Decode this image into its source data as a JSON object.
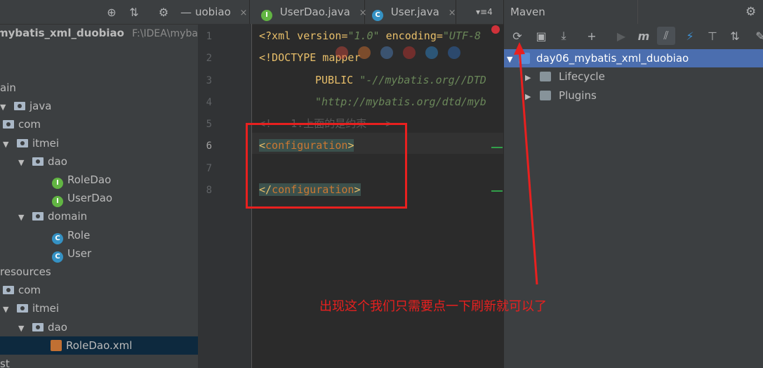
{
  "project": {
    "header_icons": [
      "globe-icon",
      "collapse-icon",
      "gear-icon",
      "minimize-icon"
    ],
    "root": {
      "name": "mybatis_xml_duobiao",
      "path": "F:\\IDEA\\mybatis\\"
    },
    "tree": [
      {
        "label": "ain",
        "depth": 0,
        "kind": "text"
      },
      {
        "label": "java",
        "depth": 0,
        "kind": "folder-arrow"
      },
      {
        "label": "com",
        "depth": 0,
        "kind": "folder"
      },
      {
        "label": "itmei",
        "depth": 1,
        "kind": "folder-arrow"
      },
      {
        "label": "dao",
        "depth": 2,
        "kind": "folder-arrow"
      },
      {
        "label": "RoleDao",
        "depth": 3,
        "kind": "interface"
      },
      {
        "label": "UserDao",
        "depth": 3,
        "kind": "interface"
      },
      {
        "label": "domain",
        "depth": 2,
        "kind": "folder-arrow"
      },
      {
        "label": "Role",
        "depth": 3,
        "kind": "class"
      },
      {
        "label": "User",
        "depth": 3,
        "kind": "class"
      },
      {
        "label": "resources",
        "depth": 0,
        "kind": "text"
      },
      {
        "label": "com",
        "depth": 0,
        "kind": "folder"
      },
      {
        "label": "itmei",
        "depth": 1,
        "kind": "folder-arrow"
      },
      {
        "label": "dao",
        "depth": 2,
        "kind": "folder-arrow"
      },
      {
        "label": "RoleDao.xml",
        "depth": 3,
        "kind": "xml",
        "selected": true
      },
      {
        "label": "st",
        "depth": 0,
        "kind": "text"
      }
    ]
  },
  "editor": {
    "tabs": [
      {
        "label": "uobiao",
        "icon": "",
        "close": "×"
      },
      {
        "label": "UserDao.java",
        "icon": "I",
        "close": "×"
      },
      {
        "label": "User.java",
        "icon": "C",
        "close": "×"
      }
    ],
    "tab_overflow": "▾≡4",
    "line_numbers": [
      "1",
      "2",
      "3",
      "4",
      "5",
      "6",
      "7",
      "8"
    ],
    "current_line": "6",
    "code": {
      "l1_a": "<?xml version=",
      "l1_b": "\"1.0\"",
      "l1_c": " encoding=",
      "l1_d": "\"UTF-8",
      "l2_a": "<!DOCTYPE mapper",
      "l3_a": "PUBLIC ",
      "l3_b": "\"-//mybatis.org//DTD",
      "l4_a": "\"http://mybatis.org/dtd/myb",
      "l5_a": "<!-- 1.上面的是约束 -->",
      "l6_open": "<",
      "l6_tag": "configuration",
      "l6_close": ">",
      "l8_open": "</",
      "l8_tag": "configuration",
      "l8_close": ">"
    }
  },
  "maven": {
    "title": "Maven",
    "toolbar": [
      "refresh-icon",
      "add-folder-icon",
      "download-icon",
      "plus-icon",
      "run-icon",
      "m-icon",
      "toggle-offline-icon",
      "thunder-icon",
      "show-deps-icon",
      "collapse-all-icon",
      "wrench-icon"
    ],
    "toolbar_glyphs": [
      "⟳",
      "▣",
      "⤓",
      "+",
      "▶",
      "m",
      "⫽",
      "⚡",
      "⊤",
      "⇅",
      "✎"
    ],
    "project": "day06_mybatis_xml_duobiao",
    "children": [
      "Lifecycle",
      "Plugins"
    ]
  },
  "annotation": "出现这个我们只需要点一下刷新就可以了",
  "colors": {
    "annotation_red": "#e8201f",
    "selection_blue": "#4b6eaf",
    "tag_orange": "#e8bf6a"
  }
}
